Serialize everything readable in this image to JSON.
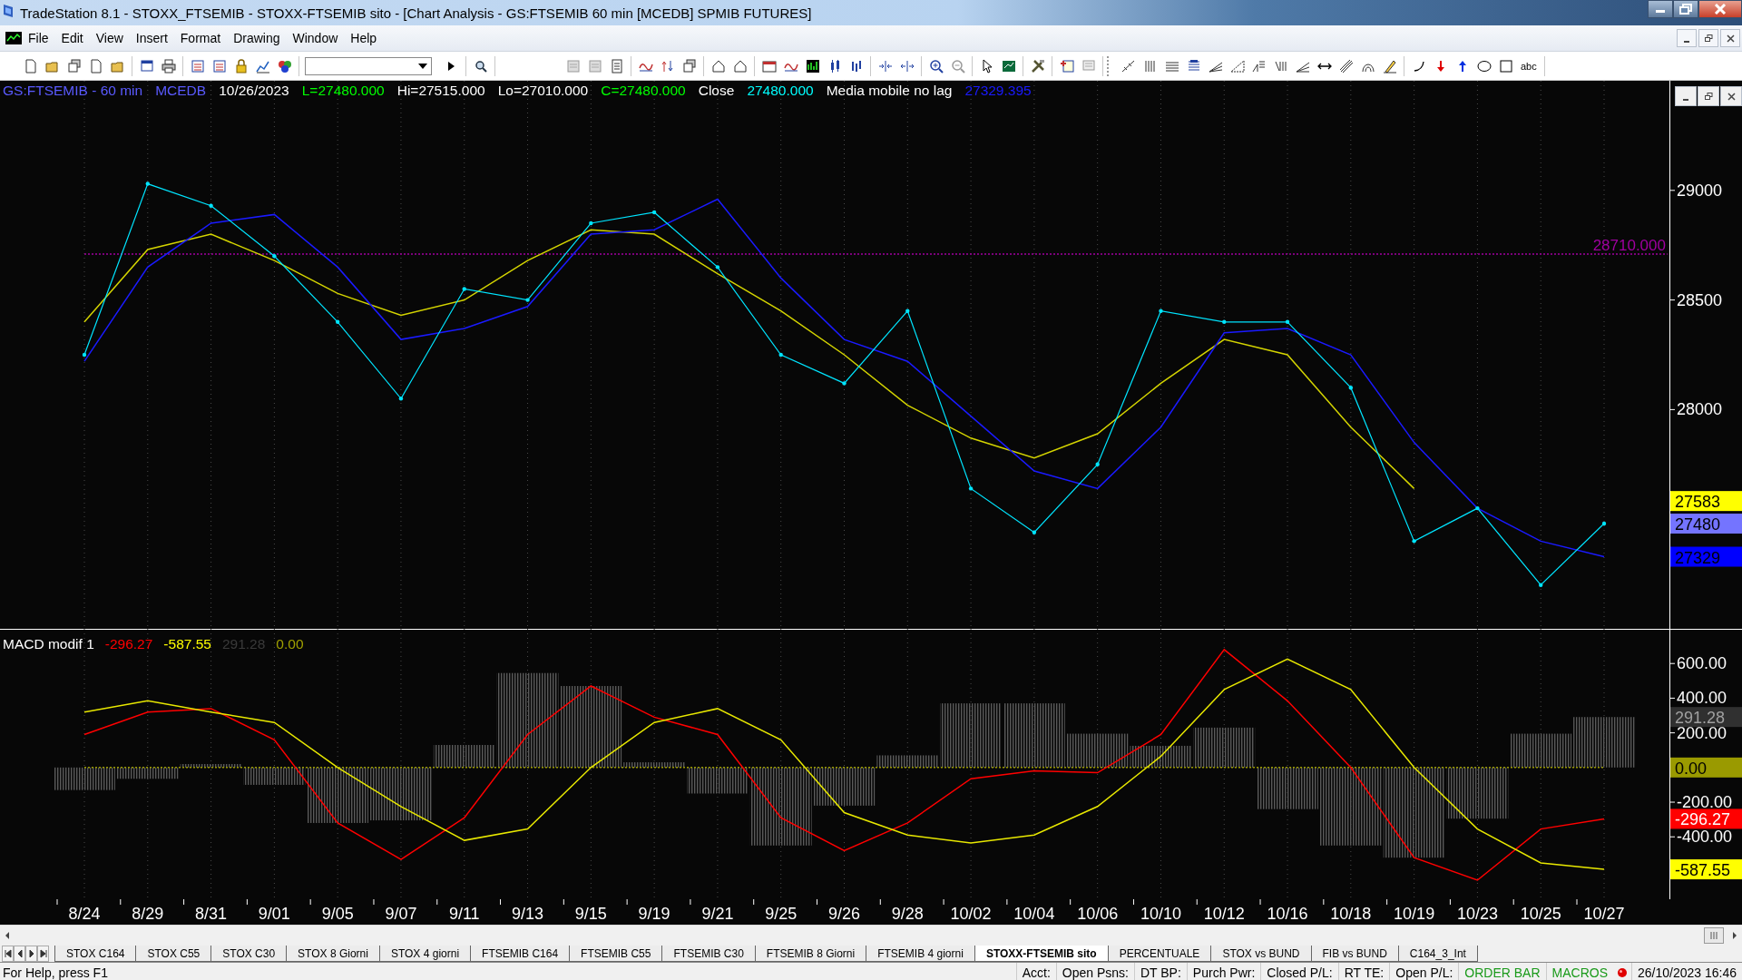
{
  "window": {
    "title": "TradeStation 8.1 - STOXX_FTSEMIB - STOXX-FTSEMIB sito - [Chart Analysis - GS:FTSEMIB  60 min  [MCEDB] SPMIB FUTURES]"
  },
  "menu": [
    "File",
    "Edit",
    "View",
    "Insert",
    "Format",
    "Drawing",
    "Window",
    "Help"
  ],
  "toolbar": {
    "text_tool": "abc"
  },
  "price_panel": {
    "header": [
      {
        "text": "GS:FTSEMIB - 60 min",
        "color": "#5a5aff"
      },
      {
        "text": "MCEDB",
        "color": "#5a5aff"
      },
      {
        "text": "10/26/2023",
        "color": "#ffffff"
      },
      {
        "text": "L=27480.000",
        "color": "#00ff00"
      },
      {
        "text": "Hi=27515.000",
        "color": "#ffffff"
      },
      {
        "text": "Lo=27010.000",
        "color": "#ffffff"
      },
      {
        "text": "C=27480.000",
        "color": "#00ff00"
      },
      {
        "text": "Close",
        "color": "#ffffff"
      },
      {
        "text": "27480.000",
        "color": "#00ffff"
      },
      {
        "text": "Media mobile no lag",
        "color": "#ffffff"
      },
      {
        "text": "27329.395",
        "color": "#1a1aff"
      }
    ],
    "price_level": {
      "label": "28710.000"
    },
    "axis_tags": [
      {
        "text": "27583",
        "color": "#ffff00"
      },
      {
        "text": "27480",
        "color": "#7474ff"
      },
      {
        "text": "27329",
        "color": "#0000ff"
      }
    ],
    "chart_data": {
      "type": "line",
      "ylim": [
        27000,
        29500
      ],
      "yticks": [
        28000,
        28500,
        29000
      ],
      "grid": true,
      "series": [
        {
          "color": "#00e5ff",
          "values": [
            28250,
            29030,
            28930,
            28700,
            28400,
            28050,
            28550,
            28500,
            28850,
            28900,
            28650,
            28250,
            28120,
            28450,
            27640,
            27440,
            27750,
            28450,
            28400,
            28400,
            28100,
            27400,
            27550,
            27200,
            27480,
            null
          ]
        },
        {
          "color": "#1a1aff",
          "values": [
            28220,
            28650,
            28850,
            28890,
            28650,
            28320,
            28370,
            28470,
            28800,
            28820,
            28960,
            28600,
            28320,
            28220,
            27970,
            27720,
            27640,
            27920,
            28350,
            28370,
            28250,
            27850,
            27550,
            27400,
            27329,
            null
          ]
        },
        {
          "color": "#d4d400",
          "values": [
            28400,
            28730,
            28800,
            28680,
            28530,
            28430,
            28500,
            28680,
            28820,
            28800,
            28620,
            28450,
            28250,
            28020,
            27870,
            27780,
            27890,
            28120,
            28320,
            28250,
            27920,
            27640,
            null,
            null,
            null,
            null
          ]
        },
        {
          "line_style": "dashed",
          "color": "#a000a0",
          "values": [
            28710,
            28710,
            28710,
            28710,
            28710,
            28710,
            28710,
            28710,
            28710,
            28710,
            28710,
            28710,
            28710,
            28710,
            28710,
            28710,
            28710,
            28710,
            28710,
            28710,
            28710,
            28710,
            28710,
            28710,
            28710,
            28710
          ]
        }
      ]
    }
  },
  "macd_panel": {
    "legend": [
      {
        "text": "MACD modif 1",
        "color": "#ffffff"
      },
      {
        "text": "-296.27",
        "color": "#ff0000"
      },
      {
        "text": "-587.55",
        "color": "#ffff00"
      },
      {
        "text": "291.28",
        "color": "#3a3a3a"
      },
      {
        "text": "0.00",
        "color": "#a0a000"
      }
    ],
    "axis_tags": [
      {
        "text": "291.28",
        "color": "#303030"
      },
      {
        "text": "0.00",
        "color": "#9a9a00"
      },
      {
        "text": "-296.27",
        "color": "#ff0000"
      },
      {
        "text": "-587.55",
        "color": "#ffff00"
      }
    ],
    "chart_data": {
      "type": "line",
      "ylim": [
        -760,
        800
      ],
      "grid": true,
      "yticks": [
        {
          "value": 600,
          "label": "600.00"
        },
        {
          "value": 400,
          "label": "400.00"
        },
        {
          "value": 200,
          "label": "200.00"
        },
        {
          "value": -200,
          "label": "-200.00"
        },
        {
          "value": -400,
          "label": "-400.00"
        }
      ],
      "categories": [
        "8/24",
        "8/29",
        "8/31",
        "9/01",
        "9/05",
        "9/07",
        "9/11",
        "9/13",
        "9/15",
        "9/19",
        "9/21",
        "9/25",
        "9/26",
        "9/28",
        "10/02",
        "10/04",
        "10/06",
        "10/10",
        "10/12",
        "10/16",
        "10/18",
        "10/19",
        "10/23",
        "10/25",
        "10/27"
      ],
      "series": [
        {
          "type": "bar",
          "color": "#5a5a5a",
          "values": [
            -130,
            -65,
            20,
            -100,
            -320,
            -305,
            130,
            545,
            470,
            30,
            -150,
            -450,
            -220,
            70,
            370,
            370,
            195,
            125,
            230,
            -240,
            -450,
            -520,
            -295,
            195,
            291
          ]
        },
        {
          "line_style": "dashed",
          "color": "#9a9a00",
          "values": [
            0,
            0,
            0,
            0,
            0,
            0,
            0,
            0,
            0,
            0,
            0,
            0,
            0,
            0,
            0,
            0,
            0,
            0,
            0,
            0,
            0,
            0,
            0,
            0,
            0
          ]
        },
        {
          "color": "#ff0000",
          "values": [
            190,
            320,
            340,
            160,
            -320,
            -530,
            -290,
            190,
            470,
            290,
            190,
            -290,
            -480,
            -320,
            -65,
            -20,
            -30,
            190,
            680,
            385,
            0,
            -520,
            -650,
            -355,
            -296
          ]
        },
        {
          "color": "#e8e800",
          "values": [
            320,
            385,
            320,
            260,
            0,
            -225,
            -420,
            -355,
            0,
            260,
            340,
            160,
            -260,
            -390,
            -435,
            -390,
            -225,
            65,
            450,
            625,
            450,
            0,
            -355,
            -550,
            -588
          ]
        }
      ]
    }
  },
  "tabs": [
    {
      "label": "STOX C164",
      "selected": false
    },
    {
      "label": "STOX C55",
      "selected": false
    },
    {
      "label": "STOX  C30",
      "selected": false
    },
    {
      "label": "STOX  8 Giorni",
      "selected": false
    },
    {
      "label": "STOX 4 giorni",
      "selected": false
    },
    {
      "label": "FTSEMIB C164",
      "selected": false
    },
    {
      "label": "FTSEMIB C55",
      "selected": false
    },
    {
      "label": "FTSEMIB C30",
      "selected": false
    },
    {
      "label": "FTSEMIB  8 Giorni",
      "selected": false
    },
    {
      "label": "FTSEMIB  4 giorni",
      "selected": false
    },
    {
      "label": "STOXX-FTSEMIB sito",
      "selected": true
    },
    {
      "label": "PERCENTUALE",
      "selected": false
    },
    {
      "label": "STOX vs BUND",
      "selected": false
    },
    {
      "label": "FIB vs BUND",
      "selected": false
    },
    {
      "label": "C164_3_Int",
      "selected": false
    }
  ],
  "status_bar": {
    "help": "For Help, press F1",
    "fields": [
      {
        "text": "Acct:",
        "color": "#000000"
      },
      {
        "text": "Open Psns:",
        "color": "#000000"
      },
      {
        "text": "DT BP:",
        "color": "#000000"
      },
      {
        "text": "Purch Pwr:",
        "color": "#000000"
      },
      {
        "text": "Closed P/L:",
        "color": "#000000"
      },
      {
        "text": "RT TE:",
        "color": "#000000"
      },
      {
        "text": "Open P/L:",
        "color": "#000000"
      },
      {
        "text": "ORDER BAR",
        "color": "#1a9a1a"
      },
      {
        "text": "MACROS",
        "color": "#1a9a1a"
      }
    ],
    "connection": {
      "on": false
    },
    "clock": "26/10/2023 16:46"
  }
}
